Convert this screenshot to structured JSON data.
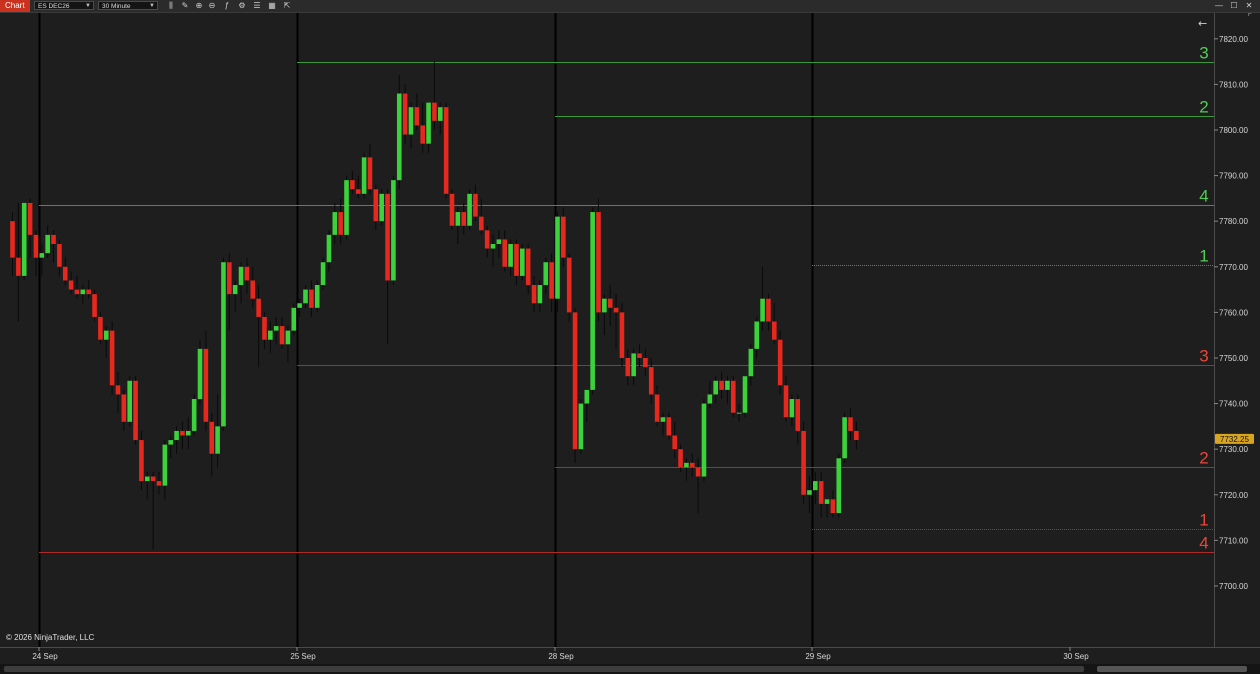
{
  "toolbar": {
    "tab_label": "Chart",
    "instrument": "ES DEC26",
    "interval": "30 Minute",
    "icons": [
      "bar-type-icon",
      "draw-icon",
      "zoom-in-icon",
      "zoom-out-icon",
      "indicators-icon",
      "strategies-icon",
      "properties-icon",
      "chart-trader-icon",
      "attach-icon"
    ],
    "window_buttons": [
      "minimize-icon",
      "maximize-icon",
      "close-icon"
    ]
  },
  "panel": {
    "back_arrow": "←",
    "corner_label": "F",
    "copyright": "© 2026 NinjaTrader, LLC"
  },
  "colors": {
    "up": "#3cd23c",
    "down": "#e6281e",
    "green_line": "#3a9a3a",
    "red_line": "#b02a2a",
    "background": "#1e1e1e",
    "last_price_bg": "#d9a520"
  },
  "last_price": "7732.25",
  "chart_data": {
    "type": "candlestick",
    "instrument": "ES DEC26",
    "interval": "30 Minute",
    "ylim": [
      7691,
      7825
    ],
    "y_ticks": [
      7700,
      7710,
      7720,
      7730,
      7740,
      7750,
      7760,
      7770,
      7780,
      7790,
      7800,
      7810,
      7820
    ],
    "y_tick_labels": [
      "7700.00",
      "7710.00",
      "7720.00",
      "7730.00",
      "7740.00",
      "7750.00",
      "7760.00",
      "7770.00",
      "7780.00",
      "7790.00",
      "7800.00",
      "7810.00",
      "7820.00"
    ],
    "x_labels": [
      {
        "label": "24 Sep",
        "bar": 5
      },
      {
        "label": "25 Sep",
        "bar": 49
      },
      {
        "label": "28 Sep",
        "bar": 93
      },
      {
        "label": "29 Sep",
        "bar": 137
      },
      {
        "label": "30 Sep",
        "bar": 181
      }
    ],
    "session_breaks": [
      5,
      49,
      93,
      137
    ],
    "candles": [
      [
        7780,
        7782,
        7768,
        7772
      ],
      [
        7772,
        7784,
        7758,
        7768
      ],
      [
        7768,
        7784,
        7767,
        7784
      ],
      [
        7784,
        7785,
        7772,
        7777
      ],
      [
        7777,
        7778,
        7768,
        7772
      ],
      [
        7772,
        7775,
        7768,
        7773
      ],
      [
        7773,
        7779,
        7772,
        7777
      ],
      [
        7777,
        7778,
        7771,
        7775
      ],
      [
        7775,
        7776,
        7768,
        7770
      ],
      [
        7770,
        7772,
        7766,
        7767
      ],
      [
        7767,
        7769,
        7764,
        7765
      ],
      [
        7765,
        7768,
        7763,
        7764
      ],
      [
        7764,
        7766,
        7762,
        7765
      ],
      [
        7765,
        7767,
        7763,
        7764
      ],
      [
        7764,
        7765,
        7758,
        7759
      ],
      [
        7759,
        7760,
        7753,
        7754
      ],
      [
        7754,
        7757,
        7750,
        7756
      ],
      [
        7756,
        7758,
        7742,
        7744
      ],
      [
        7744,
        7747,
        7738,
        7742
      ],
      [
        7742,
        7743,
        7734,
        7736
      ],
      [
        7736,
        7746,
        7735,
        7745
      ],
      [
        7745,
        7746,
        7731,
        7732
      ],
      [
        7732,
        7734,
        7721,
        7723
      ],
      [
        7723,
        7725,
        7719,
        7724
      ],
      [
        7724,
        7725,
        7708,
        7723
      ],
      [
        7723,
        7725,
        7720,
        7722
      ],
      [
        7722,
        7732,
        7719,
        7731
      ],
      [
        7731,
        7733,
        7728,
        7732
      ],
      [
        7732,
        7735,
        7729,
        7734
      ],
      [
        7734,
        7736,
        7730,
        7733
      ],
      [
        7733,
        7737,
        7730,
        7734
      ],
      [
        7734,
        7742,
        7733,
        7741
      ],
      [
        7741,
        7754,
        7740,
        7752
      ],
      [
        7752,
        7756,
        7734,
        7736
      ],
      [
        7736,
        7738,
        7724,
        7729
      ],
      [
        7729,
        7742,
        7726,
        7735
      ],
      [
        7735,
        7772,
        7734,
        7771
      ],
      [
        7771,
        7773,
        7756,
        7764
      ],
      [
        7764,
        7767,
        7760,
        7766
      ],
      [
        7766,
        7771,
        7762,
        7770
      ],
      [
        7770,
        7772,
        7764,
        7767
      ],
      [
        7767,
        7770,
        7761,
        7763
      ],
      [
        7763,
        7766,
        7748,
        7759
      ],
      [
        7759,
        7760,
        7752,
        7754
      ],
      [
        7754,
        7758,
        7751,
        7756
      ],
      [
        7756,
        7759,
        7753,
        7757
      ],
      [
        7757,
        7759,
        7752,
        7753
      ],
      [
        7753,
        7757,
        7749,
        7756
      ],
      [
        7756,
        7762,
        7755,
        7761
      ],
      [
        7761,
        7763,
        7759,
        7762
      ],
      [
        7762,
        7766,
        7761,
        7765
      ],
      [
        7765,
        7767,
        7759,
        7761
      ],
      [
        7761,
        7767,
        7760,
        7766
      ],
      [
        7766,
        7772,
        7765,
        7771
      ],
      [
        7771,
        7778,
        7769,
        7777
      ],
      [
        7777,
        7784,
        7775,
        7782
      ],
      [
        7782,
        7785,
        7775,
        7777
      ],
      [
        7777,
        7790,
        7776,
        7789
      ],
      [
        7789,
        7791,
        7786,
        7787
      ],
      [
        7787,
        7790,
        7785,
        7786
      ],
      [
        7786,
        7795,
        7785,
        7794
      ],
      [
        7794,
        7797,
        7786,
        7787
      ],
      [
        7787,
        7788,
        7778,
        7780
      ],
      [
        7780,
        7787,
        7779,
        7786
      ],
      [
        7786,
        7787,
        7753,
        7767
      ],
      [
        7767,
        7790,
        7766,
        7789
      ],
      [
        7789,
        7812,
        7787,
        7808
      ],
      [
        7808,
        7810,
        7797,
        7799
      ],
      [
        7799,
        7806,
        7796,
        7805
      ],
      [
        7805,
        7808,
        7800,
        7801
      ],
      [
        7801,
        7806,
        7795,
        7797
      ],
      [
        7797,
        7806,
        7795,
        7806
      ],
      [
        7806,
        7815,
        7800,
        7802
      ],
      [
        7802,
        7806,
        7799,
        7805
      ],
      [
        7805,
        7806,
        7785,
        7786
      ],
      [
        7786,
        7787,
        7778,
        7779
      ],
      [
        7779,
        7783,
        7775,
        7782
      ],
      [
        7782,
        7784,
        7777,
        7779
      ],
      [
        7779,
        7787,
        7778,
        7786
      ],
      [
        7786,
        7788,
        7780,
        7781
      ],
      [
        7781,
        7785,
        7777,
        7778
      ],
      [
        7778,
        7779,
        7772,
        7774
      ],
      [
        7774,
        7777,
        7770,
        7775
      ],
      [
        7775,
        7778,
        7772,
        7776
      ],
      [
        7776,
        7778,
        7769,
        7770
      ],
      [
        7770,
        7776,
        7768,
        7775
      ],
      [
        7775,
        7776,
        7766,
        7768
      ],
      [
        7768,
        7775,
        7767,
        7774
      ],
      [
        7774,
        7775,
        7764,
        7766
      ],
      [
        7766,
        7768,
        7760,
        7762
      ],
      [
        7762,
        7767,
        7760,
        7766
      ],
      [
        7766,
        7772,
        7764,
        7771
      ],
      [
        7771,
        7773,
        7760,
        7763
      ],
      [
        7763,
        7782,
        7760,
        7781
      ],
      [
        7781,
        7783,
        7770,
        7772
      ],
      [
        7772,
        7773,
        7758,
        7760
      ],
      [
        7760,
        7761,
        7727,
        7730
      ],
      [
        7730,
        7741,
        7729,
        7740
      ],
      [
        7740,
        7741,
        7736,
        7743
      ],
      [
        7743,
        7783,
        7742,
        7782
      ],
      [
        7782,
        7785,
        7758,
        7760
      ],
      [
        7760,
        7764,
        7755,
        7763
      ],
      [
        7763,
        7766,
        7757,
        7761
      ],
      [
        7761,
        7764,
        7752,
        7760
      ],
      [
        7760,
        7762,
        7748,
        7750
      ],
      [
        7750,
        7752,
        7744,
        7746
      ],
      [
        7746,
        7752,
        7744,
        7751
      ],
      [
        7751,
        7753,
        7748,
        7750
      ],
      [
        7750,
        7752,
        7746,
        7748
      ],
      [
        7748,
        7750,
        7740,
        7742
      ],
      [
        7742,
        7744,
        7735,
        7736
      ],
      [
        7736,
        7738,
        7733,
        7737
      ],
      [
        7737,
        7738,
        7732,
        7733
      ],
      [
        7733,
        7736,
        7728,
        7730
      ],
      [
        7730,
        7731,
        7725,
        7726
      ],
      [
        7726,
        7728,
        7723,
        7727
      ],
      [
        7727,
        7729,
        7724,
        7726
      ],
      [
        7726,
        7728,
        7716,
        7724
      ],
      [
        7724,
        7741,
        7723,
        7740
      ],
      [
        7740,
        7745,
        7739,
        7742
      ],
      [
        7742,
        7746,
        7740,
        7745
      ],
      [
        7745,
        7747,
        7741,
        7743
      ],
      [
        7743,
        7746,
        7740,
        7745
      ],
      [
        7745,
        7746,
        7737,
        7738
      ],
      [
        7738,
        7740,
        7736,
        7738
      ],
      [
        7738,
        7746,
        7737,
        7746
      ],
      [
        7746,
        7753,
        7744,
        7752
      ],
      [
        7752,
        7759,
        7750,
        7758
      ],
      [
        7758,
        7770,
        7756,
        7763
      ],
      [
        7763,
        7764,
        7756,
        7758
      ],
      [
        7758,
        7762,
        7753,
        7754
      ],
      [
        7754,
        7756,
        7742,
        7744
      ],
      [
        7744,
        7746,
        7736,
        7737
      ],
      [
        7737,
        7742,
        7735,
        7741
      ],
      [
        7741,
        7742,
        7731,
        7734
      ],
      [
        7734,
        7736,
        7718,
        7720
      ],
      [
        7720,
        7724,
        7716,
        7721
      ],
      [
        7721,
        7725,
        7718,
        7723
      ],
      [
        7723,
        7725,
        7715,
        7718
      ],
      [
        7718,
        7719,
        7715,
        7719
      ],
      [
        7719,
        7721,
        7715,
        7716
      ],
      [
        7716,
        7729,
        7715,
        7728
      ],
      [
        7728,
        7738,
        7727,
        7737
      ],
      [
        7737,
        7739,
        7732,
        7734
      ],
      [
        7734,
        7736,
        7730,
        7732
      ]
    ],
    "levels": [
      {
        "label": "3",
        "price": 7815,
        "color": "green",
        "from_bar": 49,
        "style": "solid"
      },
      {
        "label": "2",
        "price": 7803,
        "color": "green",
        "from_bar": 93,
        "style": "solid"
      },
      {
        "label": "4",
        "price": 7783.5,
        "color": "green",
        "from_bar": 5,
        "style": "solid"
      },
      {
        "label": "1",
        "price": 7770.5,
        "color": "green",
        "from_bar": 137,
        "style": "dotted"
      },
      {
        "label": "3",
        "price": 7748.5,
        "color": "red",
        "from_bar": 49,
        "style": "solid"
      },
      {
        "label": "2",
        "price": 7726,
        "color": "red",
        "from_bar": 93,
        "style": "solid"
      },
      {
        "label": "1",
        "price": 7712.5,
        "color": "red",
        "from_bar": 137,
        "style": "dotted"
      },
      {
        "label": "4",
        "price": 7707.5,
        "color": "red",
        "from_bar": 5,
        "style": "solid"
      }
    ]
  }
}
